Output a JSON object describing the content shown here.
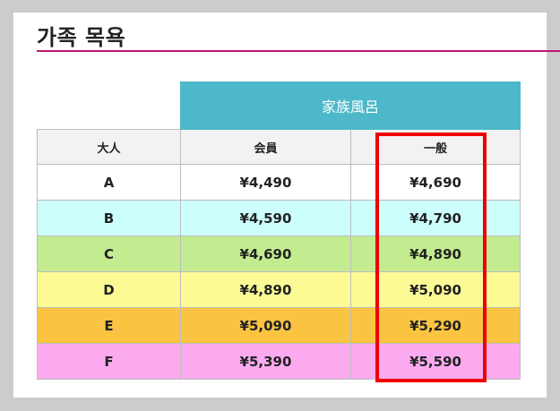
{
  "page": {
    "title": "가족 목욕"
  },
  "table": {
    "group_header": "家族風呂",
    "columns": [
      "大人",
      "会員",
      "一般"
    ],
    "rows": [
      {
        "label": "A",
        "member": "¥4,490",
        "general": "¥4,690",
        "color": "#ffffff"
      },
      {
        "label": "B",
        "member": "¥4,590",
        "general": "¥4,790",
        "color": "#ccfffc"
      },
      {
        "label": "C",
        "member": "¥4,690",
        "general": "¥4,890",
        "color": "#c3eb8f"
      },
      {
        "label": "D",
        "member": "¥4,890",
        "general": "¥5,090",
        "color": "#fcfa95"
      },
      {
        "label": "E",
        "member": "¥5,090",
        "general": "¥5,290",
        "color": "#fac442"
      },
      {
        "label": "F",
        "member": "¥5,390",
        "general": "¥5,590",
        "color": "#fcaaf0"
      }
    ]
  },
  "colors": {
    "group_header_bg": "#4db8c9",
    "title_rule": "#c0186f",
    "highlight_border": "#ee0000"
  }
}
